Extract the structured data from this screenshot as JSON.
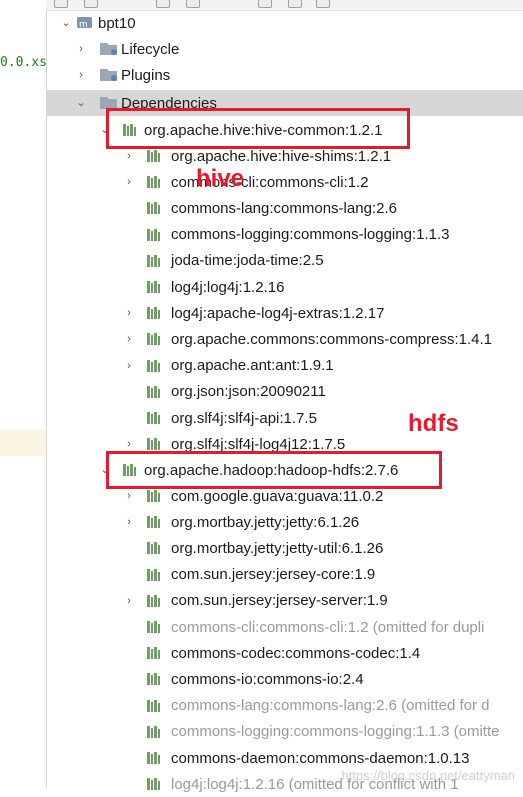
{
  "gutter": {
    "code_snippet": "0.0.xs"
  },
  "tree": {
    "root": "bpt10",
    "top_items": [
      "Lifecycle",
      "Plugins",
      "Dependencies"
    ],
    "hive_common": "org.apache.hive:hive-common:1.2.1",
    "hive_children": [
      "org.apache.hive:hive-shims:1.2.1",
      "commons-cli:commons-cli:1.2",
      "commons-lang:commons-lang:2.6",
      "commons-logging:commons-logging:1.1.3",
      "joda-time:joda-time:2.5",
      "log4j:log4j:1.2.16",
      "log4j:apache-log4j-extras:1.2.17",
      "org.apache.commons:commons-compress:1.4.1",
      "org.apache.ant:ant:1.9.1",
      "org.json:json:20090211",
      "org.slf4j:slf4j-api:1.7.5",
      "org.slf4j:slf4j-log4j12:1.7.5"
    ],
    "hadoop_hdfs": "org.apache.hadoop:hadoop-hdfs:2.7.6",
    "hdfs_children": [
      "com.google.guava:guava:11.0.2",
      "org.mortbay.jetty:jetty:6.1.26",
      "org.mortbay.jetty:jetty-util:6.1.26",
      "com.sun.jersey:jersey-core:1.9",
      "com.sun.jersey:jersey-server:1.9",
      "commons-cli:commons-cli:1.2 (omitted for dupli",
      "commons-codec:commons-codec:1.4",
      "commons-io:commons-io:2.4",
      "commons-lang:commons-lang:2.6 (omitted for d",
      "commons-logging:commons-logging:1.1.3 (omitte",
      "commons-daemon:commons-daemon:1.0.13",
      "log4j:log4j:1.2.16 (omitted for conflict with 1"
    ]
  },
  "annotations": {
    "hive_label": "hive",
    "hdfs_label": "hdfs"
  },
  "watermark": "https://blog.csdn.net/eattyman",
  "colors": {
    "annotation": "#e8192c",
    "lib_icon": "#6aa84f",
    "omitted_text": "#9a9a9a"
  }
}
